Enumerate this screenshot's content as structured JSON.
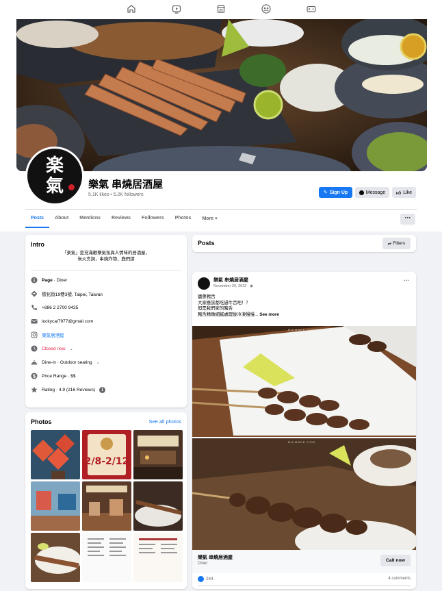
{
  "page": {
    "name": "樂氣 串燒居酒屋",
    "likes_followers": "5.1K likes • 5.2K followers",
    "avatar_text_line1": "楽",
    "avatar_text_line2": "氣"
  },
  "top_nav": {
    "icons": [
      "home-icon",
      "video-icon",
      "marketplace-icon",
      "groups-icon",
      "gaming-icon"
    ]
  },
  "actions": {
    "signup": "Sign Up",
    "message": "Message",
    "like": "Like",
    "more": "···"
  },
  "tabs": [
    "Posts",
    "About",
    "Mentions",
    "Reviews",
    "Followers",
    "Photos",
    "More ▾"
  ],
  "intro": {
    "title": "Intro",
    "bio_line1": "「楽氣」是充滿歡樂氣氛與人情味的居酒屋，",
    "bio_line2": "炭火烹調，串燒炸物，鹿們請",
    "rows": [
      {
        "icon": "info-icon",
        "bold": "Page",
        "text": " · Diner",
        "style": "normal"
      },
      {
        "icon": "location-icon",
        "text": "德化街19巷3號, Taipei, Taiwan",
        "style": "normal"
      },
      {
        "icon": "phone-icon",
        "text": "+886 2 2700 9425",
        "style": "normal"
      },
      {
        "icon": "email-icon",
        "text": "luckycat7977@gmail.com",
        "style": "normal"
      },
      {
        "icon": "instagram-icon",
        "text": "樂氣居酒屋",
        "style": "link"
      },
      {
        "icon": "clock-icon",
        "text": "Closed now",
        "style": "red",
        "suffix": "⌄"
      },
      {
        "icon": "dining-icon",
        "text": "Dine-in · Outdoor seating",
        "style": "normal",
        "suffix": "⌄"
      },
      {
        "icon": "price-icon",
        "text": "Price Range · $$",
        "style": "normal"
      },
      {
        "icon": "star-icon",
        "text": "Rating · 4.9 (216 Reviews)",
        "style": "normal",
        "suffix": "i"
      }
    ]
  },
  "photos": {
    "title": "Photos",
    "see_all": "See all photos",
    "thumb_text": "2/8-2/12"
  },
  "posts": {
    "title": "Posts",
    "filters": "Filters",
    "post": {
      "author": "樂氣 串燒居酒屋",
      "date": "November 29, 2023 · ",
      "line1": "鹽蔥豬舌",
      "line2": "大家應該都吃過牛舌吧！？",
      "line3": "但是我們家的豬舌",
      "line4": "豬舌精緻細膩處理後冷凍慢慢...",
      "see_more": "See more",
      "watermark": "MAIMAKE.COM",
      "cta_name": "樂氣 串燒居酒屋",
      "cta_sub": "Diner",
      "cta_button": "Call now",
      "reactions": "244",
      "comments": "4 comments"
    }
  },
  "colors": {
    "accent": "#1877f2",
    "background": "#f0f2f5",
    "closed_red": "#e41e3f"
  }
}
